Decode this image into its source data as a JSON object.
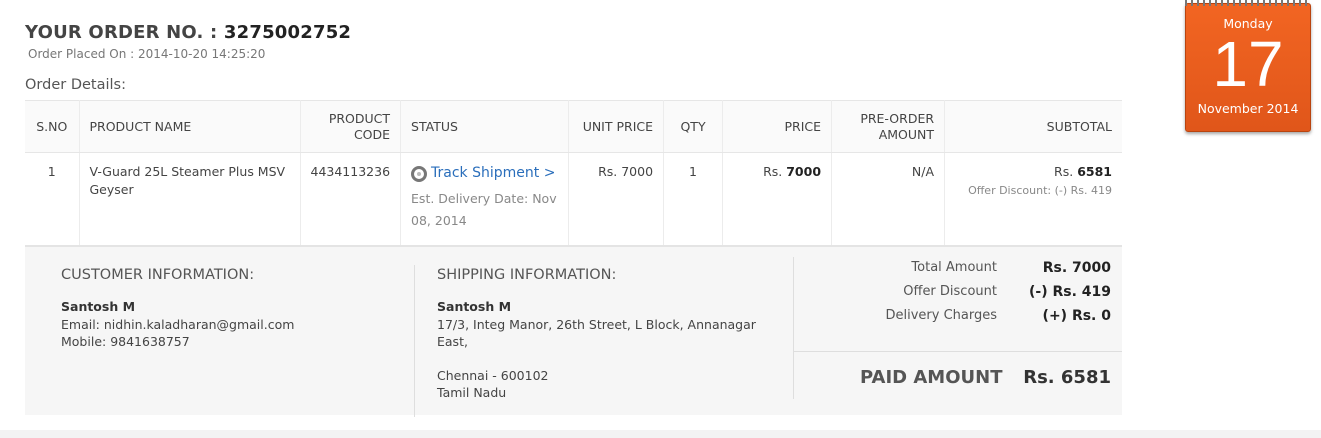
{
  "order": {
    "title_prefix": "YOUR ORDER NO. :",
    "number": "3275002752",
    "placed_on": "Order Placed On : 2014-10-20 14:25:20",
    "details_label": "Order Details:"
  },
  "table": {
    "headers": {
      "sno": "S.NO",
      "product_name": "PRODUCT NAME",
      "product_code_1": "PRODUCT",
      "product_code_2": "CODE",
      "status": "STATUS",
      "unit_price": "UNIT PRICE",
      "qty": "QTY",
      "price": "PRICE",
      "preorder_1": "PRE-ORDER",
      "preorder_2": "AMOUNT",
      "subtotal": "SUBTOTAL"
    },
    "rows": [
      {
        "sno": "1",
        "product_name": "V-Guard 25L Steamer Plus MSV Geyser",
        "product_code": "4434113236",
        "track_label": "Track Shipment >",
        "est_delivery": "Est. Delivery Date: Nov 08, 2014",
        "unit_price": "Rs. 7000",
        "qty": "1",
        "price_prefix": "Rs.",
        "price_value": "7000",
        "preorder": "N/A",
        "subtotal_prefix": "Rs.",
        "subtotal_value": "6581",
        "offer_discount": "Offer Discount: (-) Rs. 419"
      }
    ]
  },
  "customer": {
    "heading": "CUSTOMER INFORMATION:",
    "name": "Santosh M",
    "email": "Email: nidhin.kaladharan@gmail.com",
    "mobile": "Mobile: 9841638757"
  },
  "shipping": {
    "heading": "SHIPPING INFORMATION:",
    "name": "Santosh M",
    "address_1": "17/3, Integ Manor, 26th Street, L Block, Annanagar",
    "address_2": "East,",
    "city": "Chennai - 600102",
    "state": "Tamil Nadu"
  },
  "summary": {
    "total_label": "Total Amount",
    "total_value": "Rs. 7000",
    "discount_label": "Offer Discount",
    "discount_value": "(-) Rs. 419",
    "delivery_label": "Delivery Charges",
    "delivery_value": "(+) Rs. 0",
    "paid_label": "PAID AMOUNT",
    "paid_value": "Rs. 6581"
  },
  "calendar": {
    "day": "Monday",
    "date": "17",
    "month_year": "November 2014",
    "color": "#f26522"
  },
  "icons": {
    "track": "tracking-circle-icon"
  }
}
